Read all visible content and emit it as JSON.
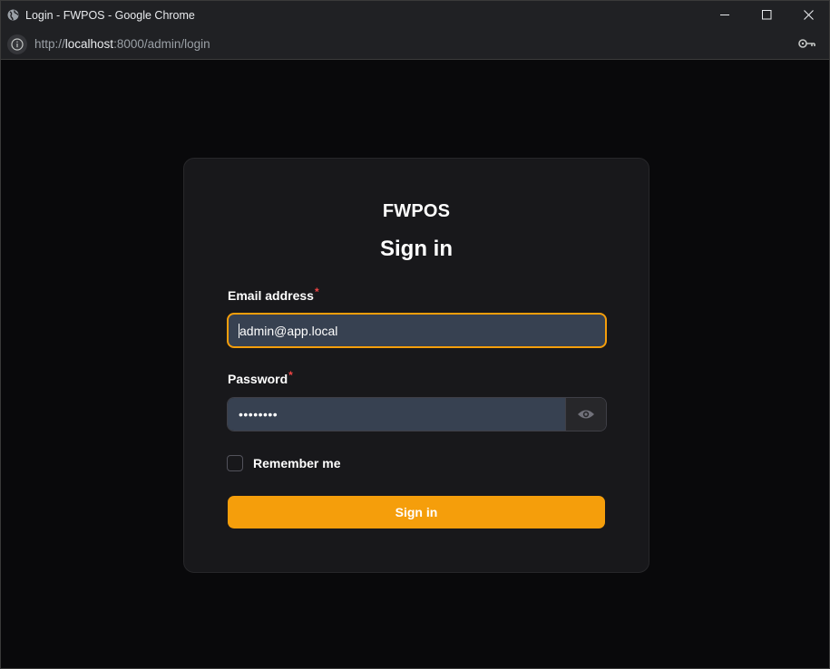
{
  "window": {
    "title": "Login - FWPOS - Google Chrome"
  },
  "address": {
    "scheme": "http://",
    "host": "localhost",
    "path": ":8000/admin/login"
  },
  "card": {
    "brand": "FWPOS",
    "heading": "Sign in",
    "email_label": "Email address",
    "email_required": "*",
    "email_value": "admin@app.local",
    "password_label": "Password",
    "password_required": "*",
    "password_value": "••••••••",
    "remember_label": "Remember me",
    "remember_checked": false,
    "submit_label": "Sign in"
  },
  "colors": {
    "accent": "#f59e0b",
    "card_bg": "#18181b",
    "page_bg": "#09090b",
    "input_bg": "#374151",
    "required": "#ef4444"
  },
  "icons": {
    "app": "globe-icon",
    "info": "info-icon",
    "key": "key-icon",
    "reveal": "eye-icon"
  }
}
